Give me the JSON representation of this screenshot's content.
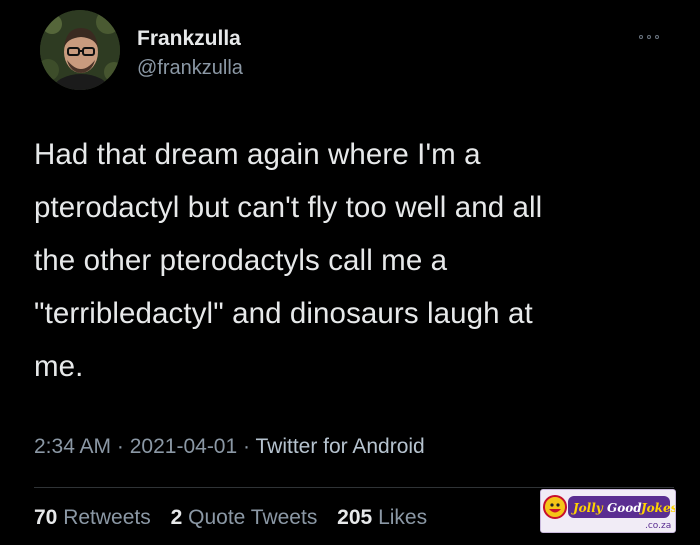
{
  "tweet": {
    "display_name": "Frankzulla",
    "handle": "@frankzulla",
    "text": "Had that dream again where I'm a\npterodactyl but can't fly too well and all\nthe other pterodactyls call me a\n\"terribledactyl\" and dinosaurs laugh at\nme.",
    "time": "2:34 AM",
    "date": "2021-04-01",
    "source": "Twitter for Android",
    "separator": "·",
    "retweets_count": "70",
    "retweets_label": "Retweets",
    "quotes_count": "2",
    "quotes_label": "Quote Tweets",
    "likes_count": "205",
    "likes_label": "Likes"
  },
  "watermark": {
    "brand": "JollyGoodJokes",
    "domain": ".co.za"
  },
  "colors": {
    "background": "#000000",
    "primary_text": "#e7e9ea",
    "secondary_text": "#8b98a5",
    "divider": "#2f3336"
  }
}
